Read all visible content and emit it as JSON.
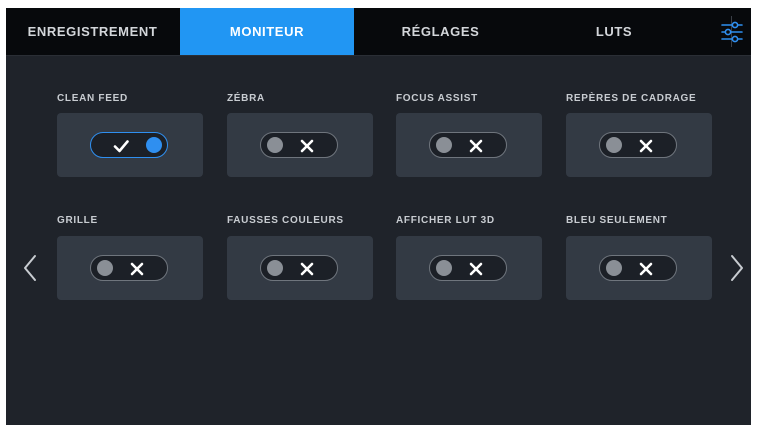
{
  "tabs": [
    {
      "label": "ENREGISTREMENT",
      "active": false
    },
    {
      "label": "MONITEUR",
      "active": true
    },
    {
      "label": "RÉGLAGES",
      "active": false
    },
    {
      "label": "LUTS",
      "active": false
    }
  ],
  "settings_icon": "sliders-icon",
  "options": [
    {
      "label": "CLEAN FEED",
      "enabled": true
    },
    {
      "label": "ZÉBRA",
      "enabled": false
    },
    {
      "label": "FOCUS ASSIST",
      "enabled": false
    },
    {
      "label": "REPÈRES DE CADRAGE",
      "enabled": false
    },
    {
      "label": "GRILLE",
      "enabled": false
    },
    {
      "label": "FAUSSES COULEURS",
      "enabled": false
    },
    {
      "label": "AFFICHER LUT 3D",
      "enabled": false
    },
    {
      "label": "BLEU SEULEMENT",
      "enabled": false
    }
  ],
  "colors": {
    "accent": "#2196f3",
    "tab_bar": "#07090c",
    "background": "#1f232a",
    "tile": "#333a44"
  }
}
